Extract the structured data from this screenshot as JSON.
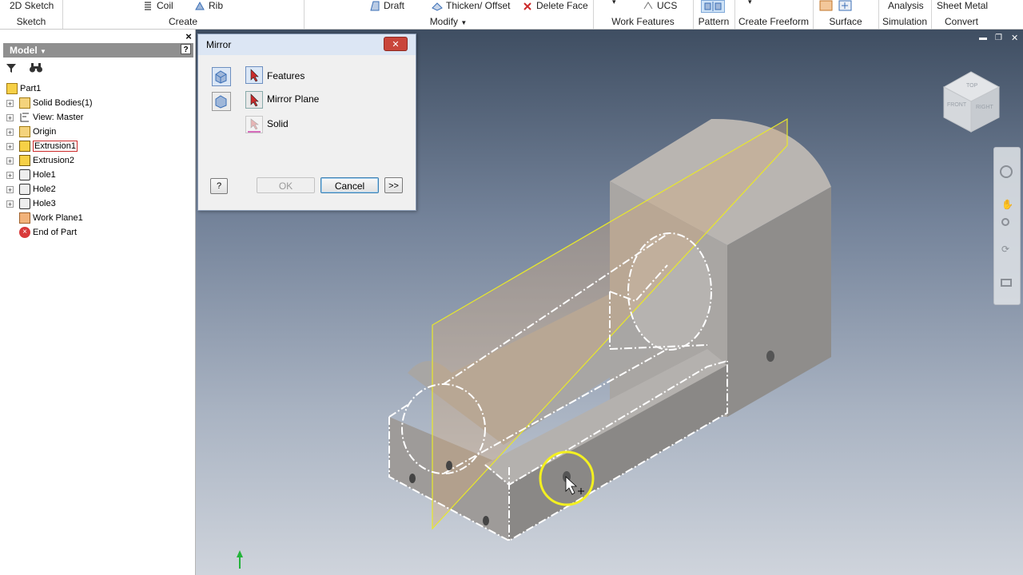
{
  "ribbon": {
    "sketch_btn": "2D Sketch",
    "sketch_group": "Sketch",
    "coil": "Coil",
    "rib": "Rib",
    "create_group": "Create",
    "draft": "Draft",
    "thicken": "Thicken/ Offset",
    "delete_face": "Delete Face",
    "modify_group": "Modify",
    "ucs": "UCS",
    "work_features_group": "Work Features",
    "pattern_group": "Pattern",
    "create_freeform_group": "Create Freeform",
    "surface_group": "Surface",
    "analysis": "Analysis",
    "simulation_group": "Simulation",
    "sheet_metal": "Sheet Metal",
    "convert_group": "Convert"
  },
  "browser": {
    "title": "Model",
    "close_glyph": "×",
    "help_glyph": "?",
    "items": [
      {
        "label": "Part1",
        "expander": "-"
      },
      {
        "label": "Solid Bodies(1)",
        "expander": "+"
      },
      {
        "label": "View: Master",
        "expander": "+"
      },
      {
        "label": "Origin",
        "expander": "+"
      },
      {
        "label": "Extrusion1",
        "expander": "+"
      },
      {
        "label": "Extrusion2",
        "expander": "+"
      },
      {
        "label": "Hole1",
        "expander": "+"
      },
      {
        "label": "Hole2",
        "expander": "+"
      },
      {
        "label": "Hole3",
        "expander": "+"
      },
      {
        "label": "Work Plane1",
        "expander": ""
      },
      {
        "label": "End of Part",
        "expander": ""
      }
    ]
  },
  "dialog": {
    "title": "Mirror",
    "close_glyph": "✕",
    "features": "Features",
    "mirror_plane": "Mirror Plane",
    "solid": "Solid",
    "ok": "OK",
    "cancel": "Cancel",
    "more": ">>",
    "help_glyph": "?"
  },
  "viewcube": {
    "top": "TOP",
    "front": "FRONT",
    "right": "RIGHT"
  },
  "window_controls": {
    "minimize": "▬",
    "restore": "❐",
    "close": "✕"
  },
  "colors": {
    "accent_blue": "#3b6fb6",
    "selection_red": "#cc2b2b",
    "workplane_yellow": "#e8e82a",
    "highlight_orange": "#d8a878",
    "browser_header": "#8f8f8f"
  }
}
